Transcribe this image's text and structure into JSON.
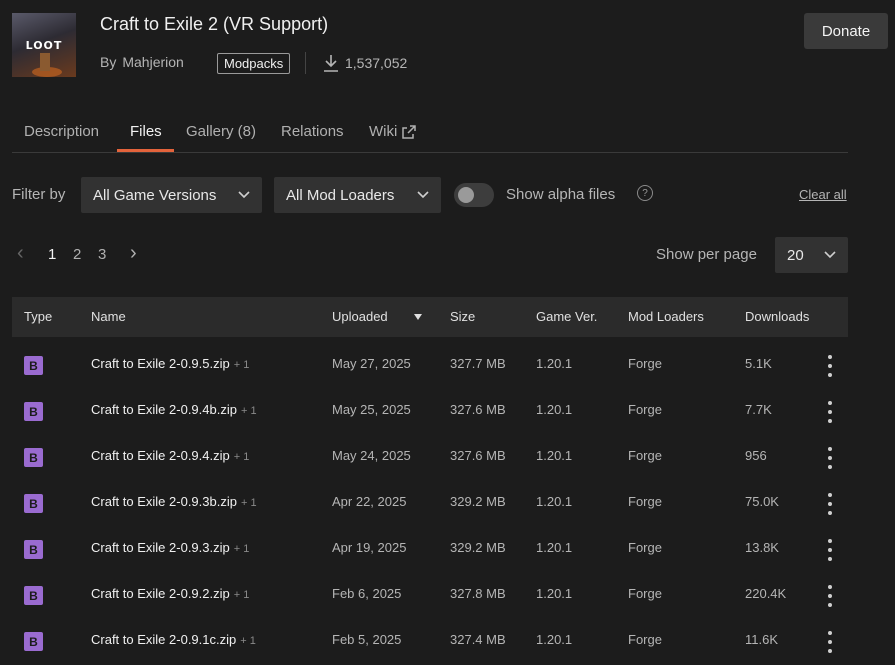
{
  "project": {
    "logo_text": "LOOT",
    "title": "Craft to Exile 2 (VR Support)",
    "by_label": "By",
    "author": "Mahjerion",
    "category": "Modpacks",
    "downloads": "1,537,052",
    "donate_label": "Donate"
  },
  "tabs": [
    {
      "label": "Description"
    },
    {
      "label": "Files",
      "active": true
    },
    {
      "label": "Gallery (8)"
    },
    {
      "label": "Relations"
    },
    {
      "label": "Wiki"
    }
  ],
  "filters": {
    "label": "Filter by",
    "game_versions": "All Game Versions",
    "mod_loaders": "All Mod Loaders",
    "alpha_label": "Show alpha files",
    "help_glyph": "?",
    "clear_label": "Clear all"
  },
  "pagination": {
    "prev_glyph": "‹",
    "pages": [
      "1",
      "2",
      "3"
    ],
    "current": "1",
    "next_glyph": "›",
    "per_page_label": "Show per page",
    "per_page_value": "20"
  },
  "table": {
    "columns": [
      "Type",
      "Name",
      "Uploaded",
      "Size",
      "Game Ver.",
      "Mod Loaders",
      "Downloads"
    ],
    "rows": [
      {
        "type": "B",
        "name": "Craft to Exile 2-0.9.5.zip",
        "extra": "+ 1",
        "uploaded": "May 27, 2025",
        "size": "327.7 MB",
        "game_ver": "1.20.1",
        "loader": "Forge",
        "downloads": "5.1K"
      },
      {
        "type": "B",
        "name": "Craft to Exile 2-0.9.4b.zip",
        "extra": "+ 1",
        "uploaded": "May 25, 2025",
        "size": "327.6 MB",
        "game_ver": "1.20.1",
        "loader": "Forge",
        "downloads": "7.7K"
      },
      {
        "type": "B",
        "name": "Craft to Exile 2-0.9.4.zip",
        "extra": "+ 1",
        "uploaded": "May 24, 2025",
        "size": "327.6 MB",
        "game_ver": "1.20.1",
        "loader": "Forge",
        "downloads": "956"
      },
      {
        "type": "B",
        "name": "Craft to Exile 2-0.9.3b.zip",
        "extra": "+ 1",
        "uploaded": "Apr 22, 2025",
        "size": "329.2 MB",
        "game_ver": "1.20.1",
        "loader": "Forge",
        "downloads": "75.0K"
      },
      {
        "type": "B",
        "name": "Craft to Exile 2-0.9.3.zip",
        "extra": "+ 1",
        "uploaded": "Apr 19, 2025",
        "size": "329.2 MB",
        "game_ver": "1.20.1",
        "loader": "Forge",
        "downloads": "13.8K"
      },
      {
        "type": "B",
        "name": "Craft to Exile 2-0.9.2.zip",
        "extra": "+ 1",
        "uploaded": "Feb 6, 2025",
        "size": "327.8 MB",
        "game_ver": "1.20.1",
        "loader": "Forge",
        "downloads": "220.4K"
      },
      {
        "type": "B",
        "name": "Craft to Exile 2-0.9.1c.zip",
        "extra": "+ 1",
        "uploaded": "Feb 5, 2025",
        "size": "327.4 MB",
        "game_ver": "1.20.1",
        "loader": "Forge",
        "downloads": "11.6K"
      }
    ]
  },
  "colors": {
    "accent": "#e3633b",
    "beta_badge": "#9a6bd0",
    "background": "#1c1c1c"
  },
  "icons": [
    "download-icon",
    "external-link-icon",
    "chevron-down-icon",
    "sort-desc-icon",
    "kebab-menu-icon",
    "help-icon"
  ]
}
